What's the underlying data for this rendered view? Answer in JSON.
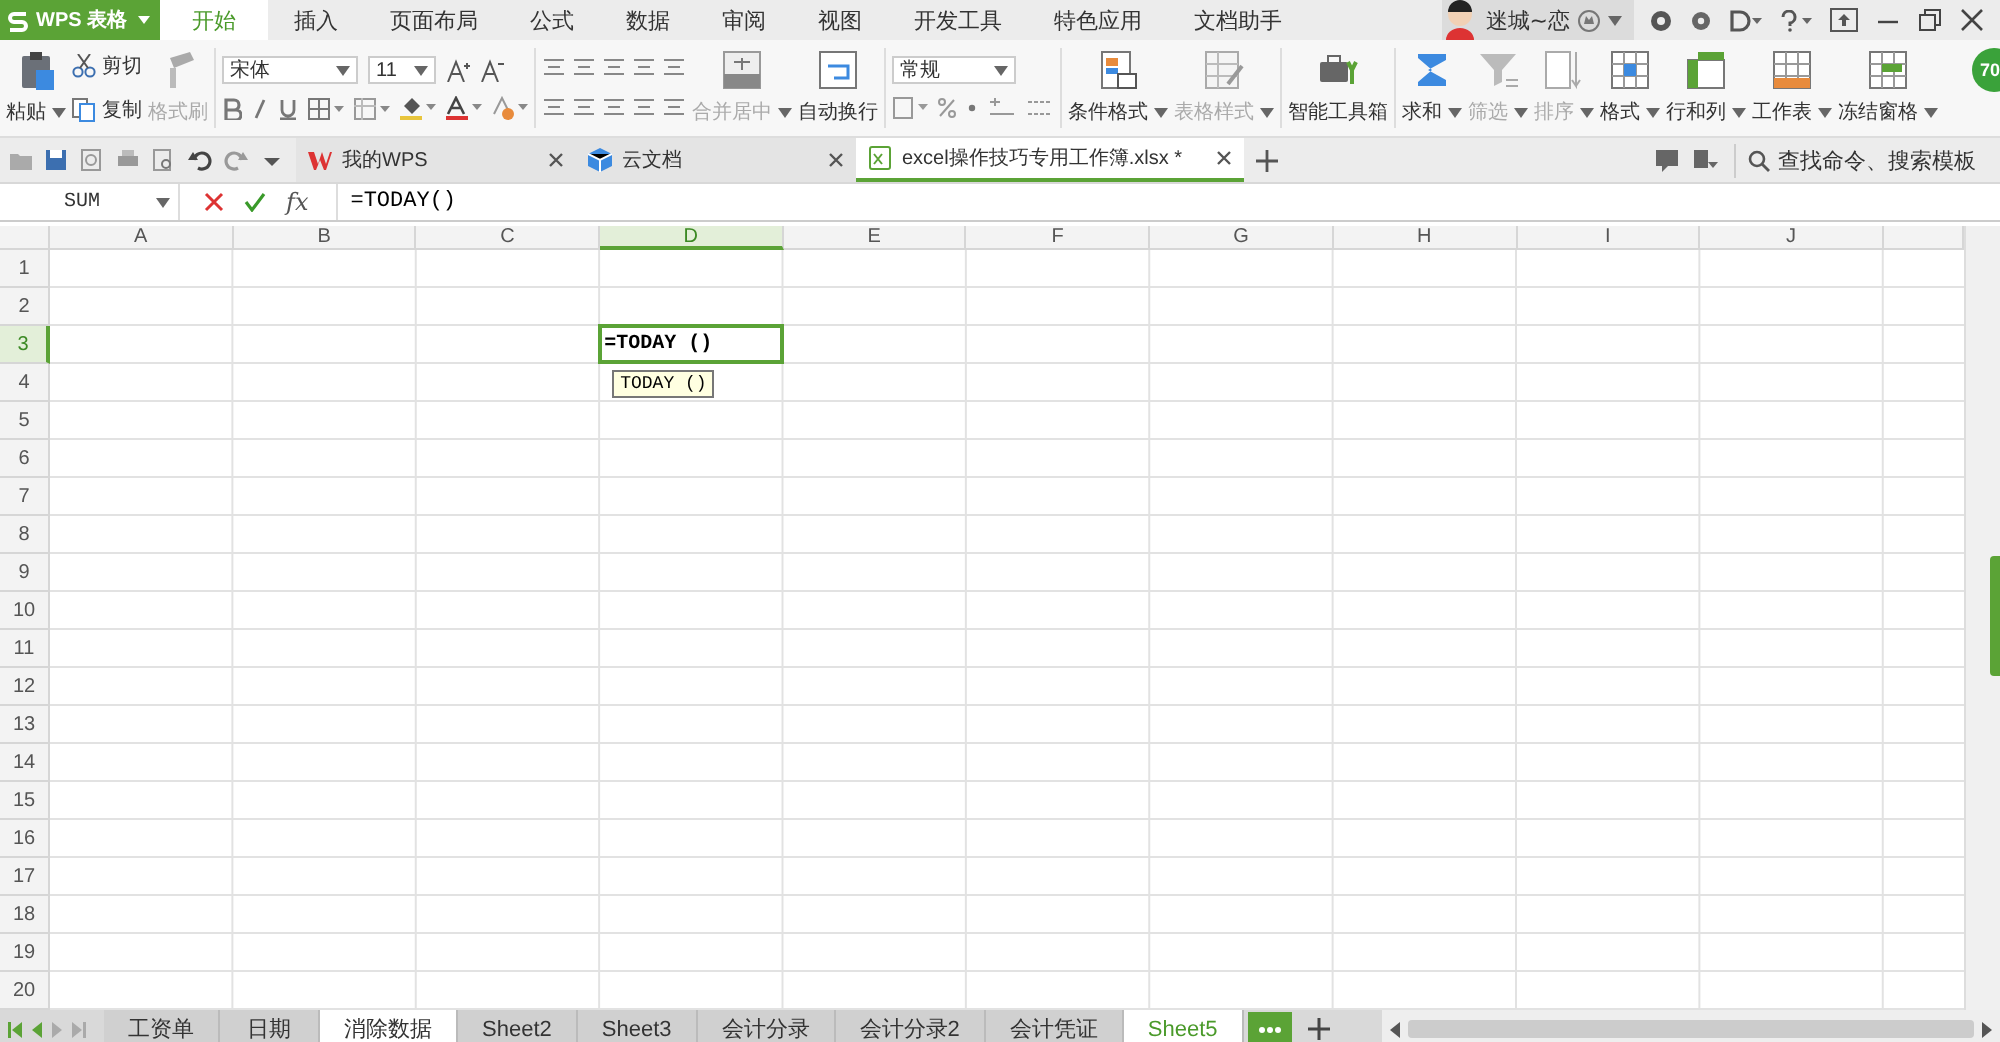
{
  "app_menu": {
    "label": "WPS 表格"
  },
  "menu_tabs": [
    {
      "label": "开始",
      "selected": true
    },
    {
      "label": "插入",
      "selected": false
    },
    {
      "label": "页面布局",
      "selected": false
    },
    {
      "label": "公式",
      "selected": false
    },
    {
      "label": "数据",
      "selected": false
    },
    {
      "label": "审阅",
      "selected": false
    },
    {
      "label": "视图",
      "selected": false
    },
    {
      "label": "开发工具",
      "selected": false
    },
    {
      "label": "特色应用",
      "selected": false
    },
    {
      "label": "文档助手",
      "selected": false
    }
  ],
  "user": {
    "name": "迷城~恋"
  },
  "ribbon": {
    "items": [
      {
        "kind": "big",
        "label": "粘贴",
        "dropdown": true,
        "disabled": false
      },
      {
        "kind": "pair",
        "items": [
          {
            "label": "剪切",
            "disabled": false
          },
          {
            "label": "复制",
            "disabled": false
          }
        ]
      },
      {
        "kind": "big",
        "label": "格式刷",
        "dropdown": false,
        "disabled": true
      },
      {
        "kind": "sep"
      },
      {
        "kind": "font",
        "font_name": "宋体",
        "font_size": "11"
      },
      {
        "kind": "sep"
      },
      {
        "kind": "align"
      },
      {
        "kind": "big",
        "label": "合并居中",
        "dropdown": true,
        "disabled": true
      },
      {
        "kind": "big",
        "label": "自动换行",
        "dropdown": false,
        "disabled": false
      },
      {
        "kind": "sep"
      },
      {
        "kind": "number",
        "format": "常规"
      },
      {
        "kind": "sep"
      },
      {
        "kind": "big",
        "label": "条件格式",
        "dropdown": true,
        "disabled": false
      },
      {
        "kind": "big",
        "label": "表格样式",
        "dropdown": true,
        "disabled": true
      },
      {
        "kind": "sep"
      },
      {
        "kind": "big",
        "label": "智能工具箱",
        "dropdown": false,
        "disabled": false
      },
      {
        "kind": "sep"
      },
      {
        "kind": "big",
        "label": "求和",
        "dropdown": true,
        "disabled": false
      },
      {
        "kind": "big",
        "label": "筛选",
        "dropdown": true,
        "disabled": true
      },
      {
        "kind": "big",
        "label": "排序",
        "dropdown": true,
        "disabled": true
      },
      {
        "kind": "big",
        "label": "格式",
        "dropdown": true,
        "disabled": false
      },
      {
        "kind": "big",
        "label": "行和列",
        "dropdown": true,
        "disabled": false
      },
      {
        "kind": "big",
        "label": "工作表",
        "dropdown": true,
        "disabled": false
      },
      {
        "kind": "big",
        "label": "冻结窗格",
        "dropdown": true,
        "disabled": false
      }
    ],
    "badge": "70"
  },
  "doc_tabs": [
    {
      "label": "我的WPS",
      "selected": false
    },
    {
      "label": "云文档",
      "selected": false
    },
    {
      "label": "excel操作技巧专用工作簿.xlsx *",
      "selected": true
    }
  ],
  "search": {
    "label": "查找命令、搜索模板"
  },
  "formula_bar": {
    "name_box": "SUM",
    "fx": "fx",
    "formula": "=TODAY()"
  },
  "grid": {
    "columns": [
      {
        "label": "A",
        "selected": false
      },
      {
        "label": "B",
        "selected": false
      },
      {
        "label": "C",
        "selected": false
      },
      {
        "label": "D",
        "selected": true
      },
      {
        "label": "E",
        "selected": false
      },
      {
        "label": "F",
        "selected": false
      },
      {
        "label": "G",
        "selected": false
      },
      {
        "label": "H",
        "selected": false
      },
      {
        "label": "I",
        "selected": false
      },
      {
        "label": "J",
        "selected": false
      }
    ],
    "rows": [
      {
        "label": "1",
        "selected": false
      },
      {
        "label": "2",
        "selected": false
      },
      {
        "label": "3",
        "selected": true
      },
      {
        "label": "4",
        "selected": false
      },
      {
        "label": "5",
        "selected": false
      },
      {
        "label": "6",
        "selected": false
      },
      {
        "label": "7",
        "selected": false
      },
      {
        "label": "8",
        "selected": false
      },
      {
        "label": "9",
        "selected": false
      },
      {
        "label": "10",
        "selected": false
      },
      {
        "label": "11",
        "selected": false
      },
      {
        "label": "12",
        "selected": false
      },
      {
        "label": "13",
        "selected": false
      },
      {
        "label": "14",
        "selected": false
      },
      {
        "label": "15",
        "selected": false
      },
      {
        "label": "16",
        "selected": false
      },
      {
        "label": "17",
        "selected": false
      },
      {
        "label": "18",
        "selected": false
      },
      {
        "label": "19",
        "selected": false
      },
      {
        "label": "20",
        "selected": false
      }
    ],
    "editor": {
      "text": "=TODAY ()",
      "hint": "TODAY ()"
    }
  },
  "sheet_tabs": [
    {
      "label": "工资单",
      "selected": false,
      "active": false
    },
    {
      "label": "日期",
      "selected": false,
      "active": false
    },
    {
      "label": "消除数据",
      "selected": true,
      "active": false
    },
    {
      "label": "Sheet2",
      "selected": false,
      "active": false
    },
    {
      "label": "Sheet3",
      "selected": false,
      "active": false
    },
    {
      "label": "会计分录",
      "selected": false,
      "active": false
    },
    {
      "label": "会计分录2",
      "selected": false,
      "active": false
    },
    {
      "label": "会计凭证",
      "selected": false,
      "active": false
    },
    {
      "label": "Sheet5",
      "selected": true,
      "active": true
    }
  ]
}
